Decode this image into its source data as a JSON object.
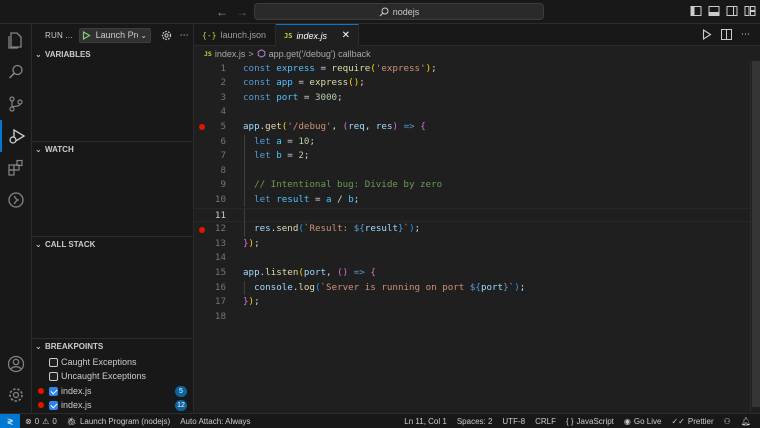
{
  "titlebar": {
    "search_text": "nodejs",
    "back_icon": "arrow-left-icon",
    "forward_icon": "arrow-right-icon"
  },
  "activity_bar": {
    "items": [
      "explorer-icon",
      "search-icon",
      "source-control-icon",
      "run-debug-icon",
      "extensions-icon",
      "remote-icon"
    ],
    "bottom": [
      "account-icon",
      "settings-gear-icon"
    ]
  },
  "sidebar": {
    "title": "RUN ...",
    "launch_config": "Launch Program",
    "sections": {
      "variables": "VARIABLES",
      "watch": "WATCH",
      "call_stack": "CALL STACK",
      "breakpoints": "BREAKPOINTS"
    },
    "breakpoints": [
      {
        "label": "Caught Exceptions",
        "checked": false,
        "dot": false,
        "badge": ""
      },
      {
        "label": "Uncaught Exceptions",
        "checked": false,
        "dot": false,
        "badge": ""
      },
      {
        "label": "index.js",
        "checked": true,
        "dot": true,
        "badge": "5"
      },
      {
        "label": "index.js",
        "checked": true,
        "dot": true,
        "badge": "12"
      }
    ]
  },
  "tabs": [
    {
      "icon": "{-}",
      "label": "launch.json",
      "active": false
    },
    {
      "icon": "JS",
      "label": "index.js",
      "active": true
    }
  ],
  "breadcrumb": {
    "file": "index.js",
    "separator": ">",
    "symbol": "app.get('/debug') callback"
  },
  "editor": {
    "current_line": 11,
    "breakpoint_lines": [
      5,
      12
    ],
    "lines": [
      {
        "n": "1",
        "code": [
          [
            "kw",
            "const "
          ],
          [
            "var",
            "express"
          ],
          [
            "op",
            " = "
          ],
          [
            "fn",
            "require"
          ],
          [
            "br1",
            "("
          ],
          [
            "str",
            "'express'"
          ],
          [
            "br1",
            ")"
          ],
          [
            "op",
            ";"
          ]
        ]
      },
      {
        "n": "2",
        "code": [
          [
            "kw",
            "const "
          ],
          [
            "var",
            "app"
          ],
          [
            "op",
            " = "
          ],
          [
            "fn",
            "express"
          ],
          [
            "br1",
            "()"
          ],
          [
            "op",
            ";"
          ]
        ]
      },
      {
        "n": "3",
        "code": [
          [
            "kw",
            "const "
          ],
          [
            "var",
            "port"
          ],
          [
            "op",
            " = "
          ],
          [
            "num",
            "3000"
          ],
          [
            "op",
            ";"
          ]
        ]
      },
      {
        "n": "4",
        "code": []
      },
      {
        "n": "5",
        "code": [
          [
            "prm",
            "app"
          ],
          [
            "op",
            "."
          ],
          [
            "fn",
            "get"
          ],
          [
            "br1",
            "("
          ],
          [
            "str",
            "'/debug'"
          ],
          [
            "op",
            ", "
          ],
          [
            "br2",
            "("
          ],
          [
            "prm",
            "req"
          ],
          [
            "op",
            ", "
          ],
          [
            "prm",
            "res"
          ],
          [
            "br2",
            ")"
          ],
          [
            "op",
            " "
          ],
          [
            "kw",
            "=>"
          ],
          [
            "op",
            " "
          ],
          [
            "br2",
            "{"
          ]
        ]
      },
      {
        "n": "6",
        "code": [
          [
            "op",
            "  "
          ],
          [
            "kw",
            "let "
          ],
          [
            "var",
            "a"
          ],
          [
            "op",
            " = "
          ],
          [
            "num",
            "10"
          ],
          [
            "op",
            ";"
          ]
        ]
      },
      {
        "n": "7",
        "code": [
          [
            "op",
            "  "
          ],
          [
            "kw",
            "let "
          ],
          [
            "var",
            "b"
          ],
          [
            "op",
            " = "
          ],
          [
            "num",
            "2"
          ],
          [
            "op",
            ";"
          ]
        ]
      },
      {
        "n": "8",
        "code": []
      },
      {
        "n": "9",
        "code": [
          [
            "op",
            "  "
          ],
          [
            "cmt",
            "// Intentional bug: Divide by zero"
          ]
        ]
      },
      {
        "n": "10",
        "code": [
          [
            "op",
            "  "
          ],
          [
            "kw",
            "let "
          ],
          [
            "var",
            "result"
          ],
          [
            "op",
            " = "
          ],
          [
            "var",
            "a"
          ],
          [
            "op",
            " / "
          ],
          [
            "var",
            "b"
          ],
          [
            "op",
            ";"
          ]
        ]
      },
      {
        "n": "11",
        "code": []
      },
      {
        "n": "12",
        "code": [
          [
            "op",
            "  "
          ],
          [
            "prm",
            "res"
          ],
          [
            "op",
            "."
          ],
          [
            "fn",
            "send"
          ],
          [
            "br3",
            "("
          ],
          [
            "str",
            "`Result: "
          ],
          [
            "tmp",
            "${"
          ],
          [
            "prm",
            "result"
          ],
          [
            "tmp",
            "}"
          ],
          [
            "str",
            "`"
          ],
          [
            "br3",
            ")"
          ],
          [
            "op",
            ";"
          ]
        ]
      },
      {
        "n": "13",
        "code": [
          [
            "br2",
            "}"
          ],
          [
            "br1",
            ")"
          ],
          [
            "op",
            ";"
          ]
        ]
      },
      {
        "n": "14",
        "code": []
      },
      {
        "n": "15",
        "code": [
          [
            "prm",
            "app"
          ],
          [
            "op",
            "."
          ],
          [
            "fn",
            "listen"
          ],
          [
            "br1",
            "("
          ],
          [
            "prm",
            "port"
          ],
          [
            "op",
            ", "
          ],
          [
            "br2",
            "()"
          ],
          [
            "op",
            " "
          ],
          [
            "kw",
            "=>"
          ],
          [
            "op",
            " "
          ],
          [
            "br2",
            "{"
          ]
        ]
      },
      {
        "n": "16",
        "code": [
          [
            "op",
            "  "
          ],
          [
            "prm",
            "console"
          ],
          [
            "op",
            "."
          ],
          [
            "fn",
            "log"
          ],
          [
            "br3",
            "("
          ],
          [
            "str",
            "`Server is running on port "
          ],
          [
            "tmp",
            "${"
          ],
          [
            "prm",
            "port"
          ],
          [
            "tmp",
            "}"
          ],
          [
            "str",
            "`"
          ],
          [
            "br3",
            ")"
          ],
          [
            "op",
            ";"
          ]
        ]
      },
      {
        "n": "17",
        "code": [
          [
            "br2",
            "}"
          ],
          [
            "br1",
            ")"
          ],
          [
            "op",
            ";"
          ]
        ]
      },
      {
        "n": "18",
        "code": []
      }
    ]
  },
  "statusbar": {
    "errors": "0",
    "warnings": "0",
    "launch": "Launch Program (nodejs)",
    "auto_attach": "Auto Attach: Always",
    "position": "Ln 11, Col 1",
    "spaces": "Spaces: 2",
    "encoding": "UTF-8",
    "eol": "CRLF",
    "language": "JavaScript",
    "go_live": "Go Live",
    "prettier": "Prettier"
  },
  "colors": {
    "accent": "#0078d4",
    "breakpoint": "#e51400",
    "badge": "#0e639c"
  }
}
